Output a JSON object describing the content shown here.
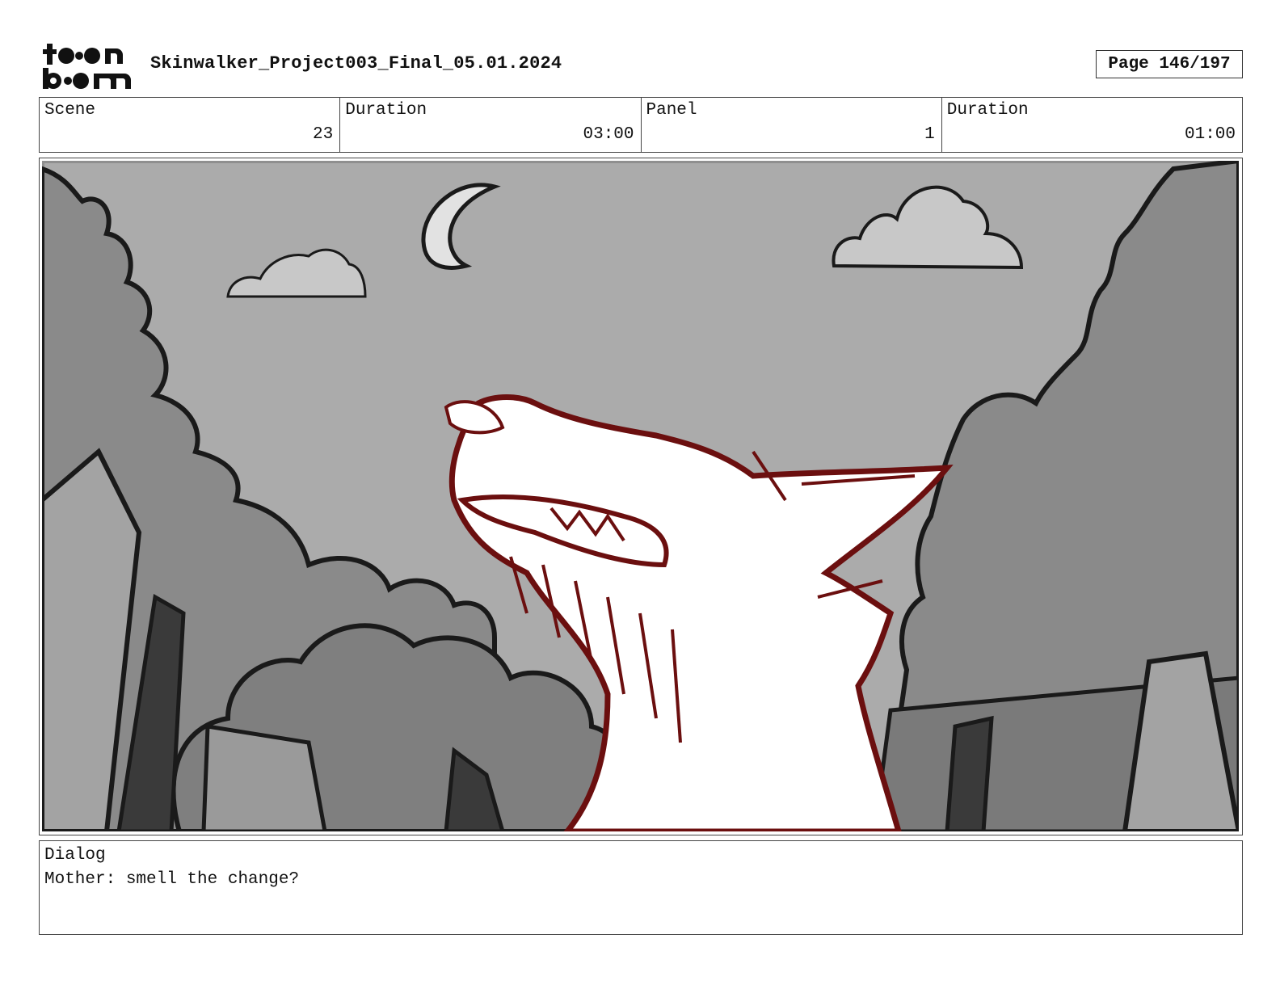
{
  "header": {
    "logo_text": "toon boom",
    "project_title": "Skinwalker_Project003_Final_05.01.2024",
    "page_indicator": "Page 146/197"
  },
  "info": {
    "scene_label": "Scene",
    "scene_value": "23",
    "scene_duration_label": "Duration",
    "scene_duration_value": "03:00",
    "panel_label": "Panel",
    "panel_value": "1",
    "panel_duration_label": "Duration",
    "panel_duration_value": "01:00"
  },
  "panel": {
    "colors": {
      "sky": "#ababab",
      "trees": "#8a8a8a",
      "trunk": "#3a3a3a",
      "outline": "#1a1a1a",
      "creature_line": "#6b0f0f",
      "creature_fill": "#ffffff",
      "moon": "#e2e2e2",
      "cloud": "#c8c8c8"
    }
  },
  "dialog": {
    "label": "Dialog",
    "text": "Mother: smell the change?"
  }
}
